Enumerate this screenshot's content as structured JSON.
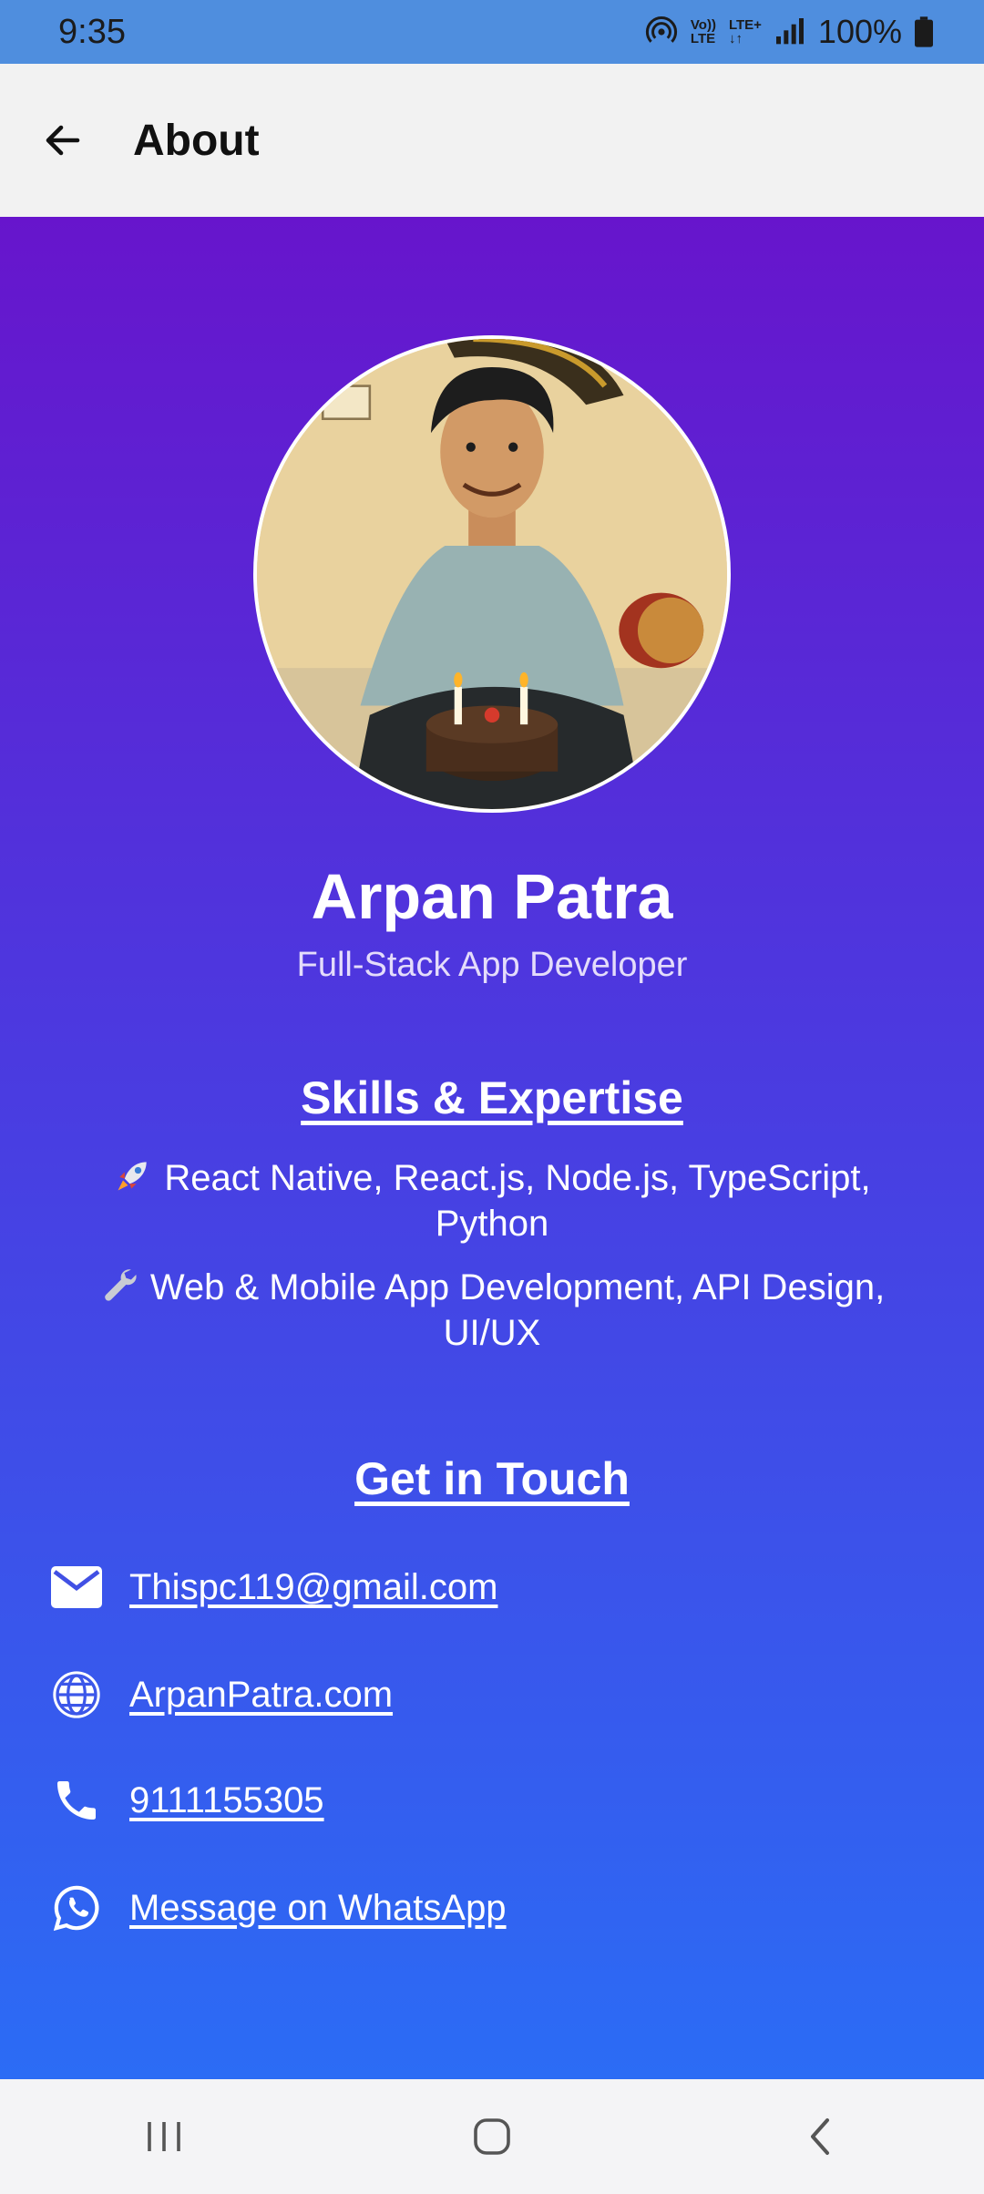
{
  "status_bar": {
    "time": "9:35",
    "volte_top": "Vo))",
    "volte_bottom": "LTE",
    "lte_top": "LTE+",
    "lte_bottom": "↓↑",
    "battery_text": "100%"
  },
  "app_bar": {
    "title": "About",
    "back_icon": "arrow-left-icon"
  },
  "profile": {
    "name": "Arpan Patra",
    "role": "Full-Stack App Developer"
  },
  "skills": {
    "title": "Skills & Expertise",
    "items": [
      {
        "icon": "rocket-icon",
        "text": "React Native, React.js, Node.js, TypeScript, Python"
      },
      {
        "icon": "wrench-icon",
        "text": "Web & Mobile App Development, API Design, UI/UX"
      }
    ]
  },
  "contact": {
    "title": "Get in Touch",
    "items": [
      {
        "icon": "mail-icon",
        "text": "Thispc119@gmail.com"
      },
      {
        "icon": "globe-icon",
        "text": "ArpanPatra.com"
      },
      {
        "icon": "phone-icon",
        "text": "9111155305"
      },
      {
        "icon": "whatsapp-icon",
        "text": "Message on WhatsApp"
      }
    ]
  },
  "colors": {
    "status_bar": "#4f8ede",
    "gradient_top": "#6715cc",
    "gradient_bottom": "#2b6cf5",
    "app_bar": "#f2f2f2"
  }
}
